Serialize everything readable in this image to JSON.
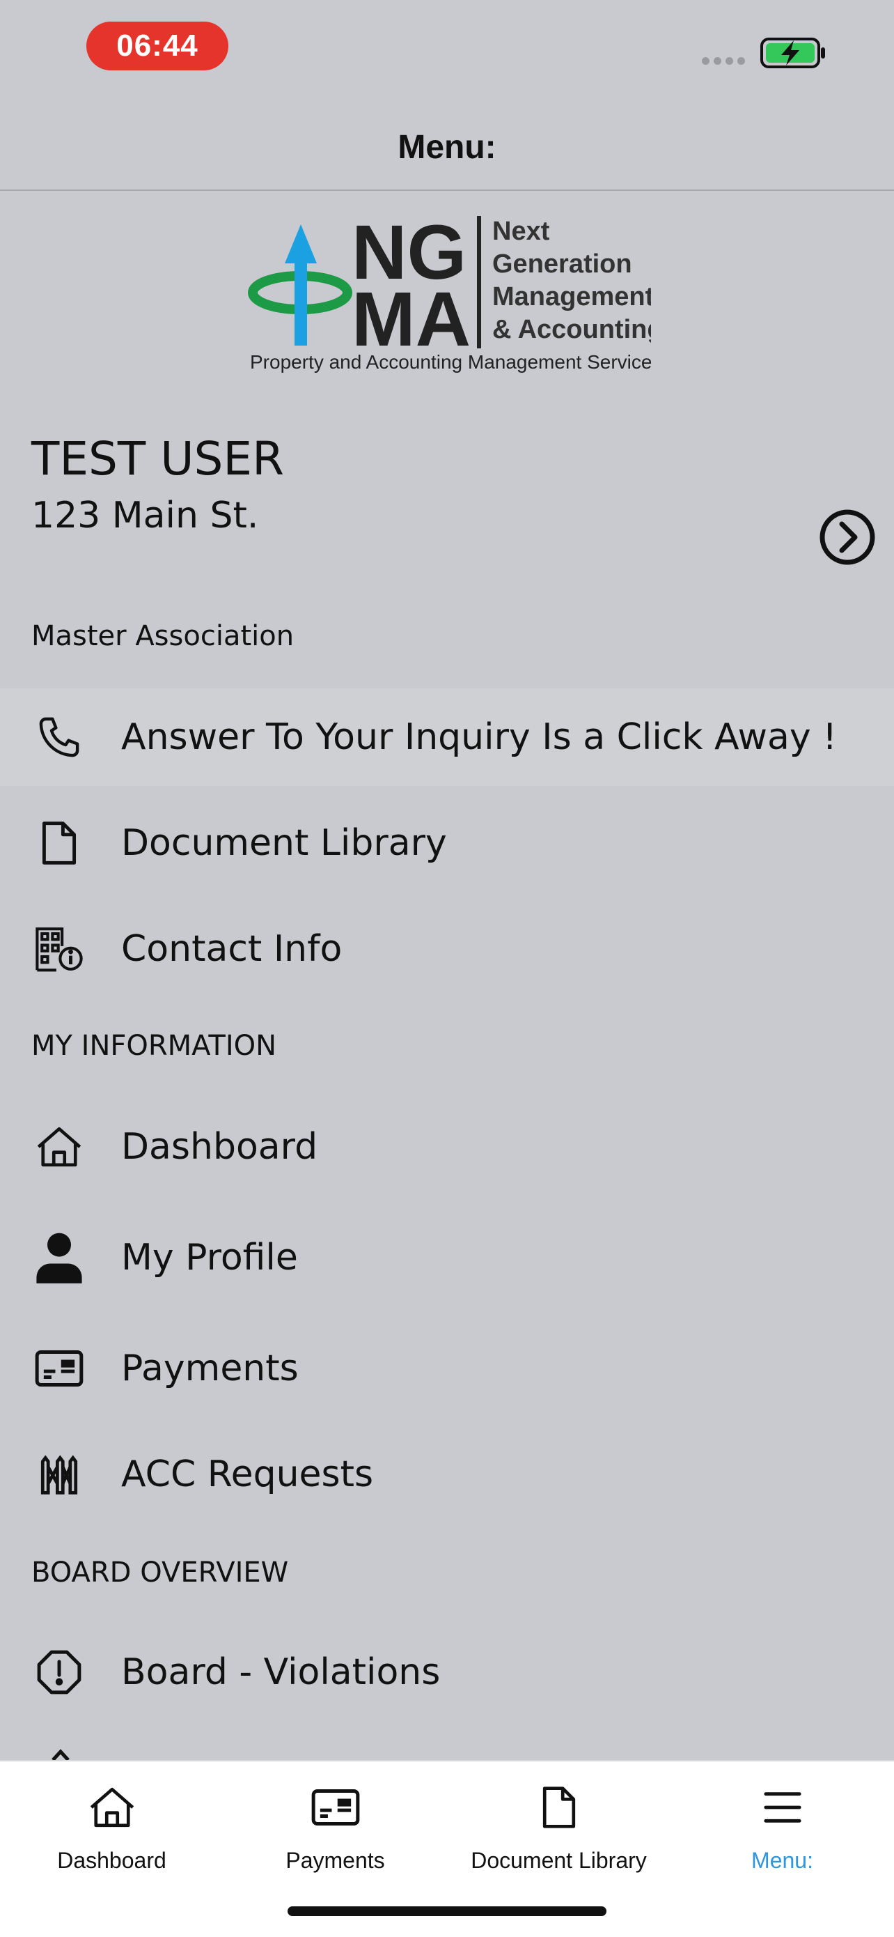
{
  "status_bar": {
    "time": "06:44"
  },
  "header": {
    "title": "Menu:"
  },
  "logo": {
    "letters_top": "NG",
    "letters_bottom": "MA",
    "line1": "Next",
    "line2": "Generation",
    "line3": "Management",
    "line4": "& Accounting",
    "tagline": "Property and Accounting Management Services"
  },
  "user": {
    "name": "TEST USER",
    "address": "123 Main St."
  },
  "sections": {
    "master": "Master Association",
    "my_info": "MY INFORMATION",
    "board": "BOARD OVERVIEW"
  },
  "menu": {
    "inquiry": {
      "label": "Answer To Your Inquiry Is a Click Away !",
      "icon": "phone-icon"
    },
    "documents": {
      "label": "Document Library",
      "icon": "document-icon"
    },
    "contact": {
      "label": "Contact Info",
      "icon": "building-info-icon"
    },
    "dashboard": {
      "label": "Dashboard",
      "icon": "home-icon"
    },
    "profile": {
      "label": "My Profile",
      "icon": "person-icon"
    },
    "payments": {
      "label": "Payments",
      "icon": "payment-card-icon"
    },
    "acc": {
      "label": "ACC Requests",
      "icon": "fence-icon"
    },
    "violations": {
      "label": "Board - Violations",
      "icon": "alert-icon"
    }
  },
  "tabs": [
    {
      "label": "Dashboard",
      "icon": "home-icon"
    },
    {
      "label": "Payments",
      "icon": "payment-card-icon"
    },
    {
      "label": "Document Library",
      "icon": "document-icon"
    },
    {
      "label": "Menu:",
      "icon": "hamburger-icon",
      "active": true
    }
  ],
  "colors": {
    "background": "#c9cacf",
    "time_pill": "#e5342b",
    "battery": "#34c759",
    "active_tab": "#2f95dc",
    "logo_arrow": "#1ba1e2",
    "logo_ring": "#1c9a45"
  }
}
